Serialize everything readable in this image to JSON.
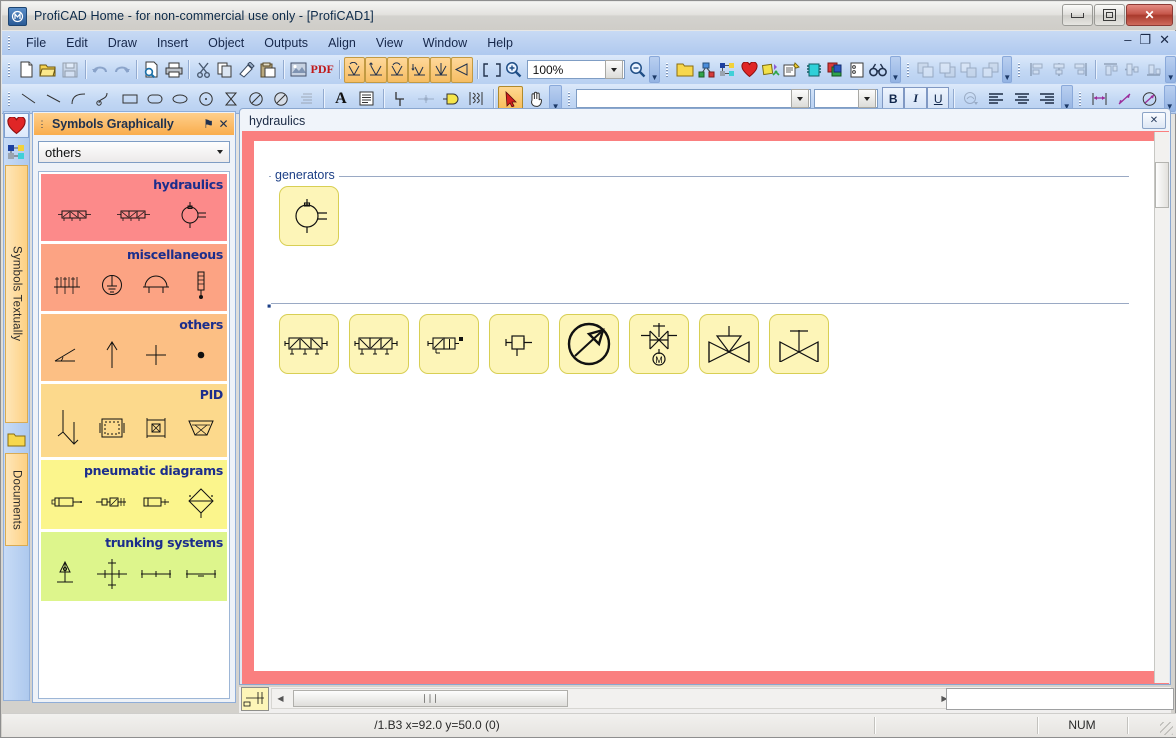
{
  "window": {
    "title": "ProfiCAD Home - for non-commercial use only - [ProfiCAD1]",
    "app_icon": "proficad-icon",
    "minimize": "–",
    "maximize": "□",
    "close": "✕"
  },
  "mdi_controls": {
    "minimize": "–",
    "restore": "❐",
    "close": "✕"
  },
  "menu": {
    "items": [
      {
        "label": "File"
      },
      {
        "label": "Edit"
      },
      {
        "label": "Draw"
      },
      {
        "label": "Insert"
      },
      {
        "label": "Object"
      },
      {
        "label": "Outputs"
      },
      {
        "label": "Align"
      },
      {
        "label": "View"
      },
      {
        "label": "Window"
      },
      {
        "label": "Help"
      }
    ]
  },
  "toolbar_main": {
    "zoom_value": "100%",
    "buttons": [
      {
        "name": "new-icon",
        "label": "New"
      },
      {
        "name": "open-icon",
        "label": "Open"
      },
      {
        "name": "save-icon",
        "label": "Save"
      },
      {
        "name": "undo-icon",
        "label": "Undo"
      },
      {
        "name": "redo-icon",
        "label": "Redo"
      },
      {
        "name": "print-preview-icon",
        "label": "Print Preview"
      },
      {
        "name": "print-icon",
        "label": "Print"
      },
      {
        "name": "cut-icon",
        "label": "Cut"
      },
      {
        "name": "copy-icon",
        "label": "Copy"
      },
      {
        "name": "format-painter-icon",
        "label": "Format Painter"
      },
      {
        "name": "paste-icon",
        "label": "Paste"
      },
      {
        "name": "image-export-icon",
        "label": "Export Image"
      },
      {
        "name": "pdf-icon",
        "label": "PDF"
      },
      {
        "name": "rotate-left-icon",
        "label": "Rotate Left"
      },
      {
        "name": "rotate-right-icon",
        "label": "Rotate Right"
      },
      {
        "name": "rotate-180-icon",
        "label": "Rotate 180"
      },
      {
        "name": "flip-vertical-icon",
        "label": "Flip Vertical"
      },
      {
        "name": "mirror-horizontal-icon",
        "label": "Mirror Horizontal"
      },
      {
        "name": "mirror-vertical-icon",
        "label": "Mirror Vertical"
      },
      {
        "name": "zoom-fit-icon",
        "label": "Zoom to Fit"
      },
      {
        "name": "zoom-in-icon",
        "label": "Zoom In"
      },
      {
        "name": "zoom-out-icon",
        "label": "Zoom Out"
      }
    ]
  },
  "toolbar_panels": {
    "buttons": [
      {
        "name": "folder-icon",
        "label": "Symbol Library"
      },
      {
        "name": "netlist-icon",
        "label": "Netlist"
      },
      {
        "name": "hierarchy-icon",
        "label": "Hierarchy"
      },
      {
        "name": "favorites-heart-icon",
        "label": "Favorites"
      },
      {
        "name": "symbols-graphically-icon",
        "label": "Symbols Graphically"
      },
      {
        "name": "notes-icon",
        "label": "Notes"
      },
      {
        "name": "component-icon",
        "label": "Component"
      },
      {
        "name": "layers-icon",
        "label": "Layers"
      },
      {
        "name": "page-icon",
        "label": "Page"
      },
      {
        "name": "find-icon",
        "label": "Find"
      }
    ]
  },
  "toolbar_order": {
    "buttons": [
      {
        "name": "bring-to-front-icon",
        "label": "Bring to Front"
      },
      {
        "name": "send-to-back-icon",
        "label": "Send to Back"
      },
      {
        "name": "bring-forward-icon",
        "label": "Bring Forward"
      },
      {
        "name": "send-backward-icon",
        "label": "Send Backward"
      }
    ]
  },
  "toolbar_align": {
    "buttons": [
      {
        "name": "align-left-icon",
        "label": "Align Left"
      },
      {
        "name": "align-center-icon",
        "label": "Align Center"
      },
      {
        "name": "align-right-icon",
        "label": "Align Right"
      },
      {
        "name": "align-top-icon",
        "label": "Align Top"
      },
      {
        "name": "align-middle-icon",
        "label": "Align Middle"
      },
      {
        "name": "align-bottom-icon",
        "label": "Align Bottom"
      }
    ]
  },
  "toolbar_draw": {
    "font_name": "",
    "font_size": "",
    "bold_label": "B",
    "italic_label": "I",
    "underline_label": "U",
    "buttons": [
      {
        "name": "line-icon",
        "label": "Line"
      },
      {
        "name": "line2-icon",
        "label": "Line"
      },
      {
        "name": "arc-icon",
        "label": "Arc"
      },
      {
        "name": "bezier-icon",
        "label": "Bezier"
      },
      {
        "name": "rectangle-icon",
        "label": "Rectangle"
      },
      {
        "name": "rounded-rectangle-icon",
        "label": "Rounded Rectangle"
      },
      {
        "name": "ellipse-icon",
        "label": "Ellipse"
      },
      {
        "name": "circle-icon",
        "label": "Circle"
      },
      {
        "name": "hourglass-icon",
        "label": "Hourglass"
      },
      {
        "name": "no-fill-ellipse-icon",
        "label": "Ellipse Slash"
      },
      {
        "name": "filled-ellipse-icon",
        "label": "Filled Ellipse"
      },
      {
        "name": "hatch-icon",
        "label": "Hatch"
      },
      {
        "name": "text-icon",
        "label": "Text"
      },
      {
        "name": "textbox-icon",
        "label": "Text Box"
      },
      {
        "name": "wire-icon",
        "label": "Wire"
      },
      {
        "name": "junction-icon",
        "label": "Junction"
      },
      {
        "name": "terminal-icon",
        "label": "Terminal"
      },
      {
        "name": "bus-icon",
        "label": "Bus"
      },
      {
        "name": "select-arrow-icon",
        "label": "Select"
      },
      {
        "name": "pan-hand-icon",
        "label": "Pan"
      },
      {
        "name": "color-picker-icon",
        "label": "Color"
      },
      {
        "name": "align-text-left-icon",
        "label": "Align Text Left"
      },
      {
        "name": "align-text-center-icon",
        "label": "Align Text Center"
      },
      {
        "name": "align-text-right-icon",
        "label": "Align Text Right"
      },
      {
        "name": "dimension-linear-icon",
        "label": "Linear Dimension"
      },
      {
        "name": "dimension-angular-icon",
        "label": "Angular Dimension"
      },
      {
        "name": "dimension-radial-icon",
        "label": "Radial Dimension"
      }
    ]
  },
  "dock": {
    "icons": [
      {
        "name": "favorites-heart-icon",
        "label": "Favorites",
        "selected": true
      },
      {
        "name": "symbols-graphically-icon",
        "label": "Symbols Graphically",
        "selected": false
      }
    ],
    "tabs": [
      {
        "label": "Symbols Textually",
        "name": "symbols-textually"
      },
      {
        "label": "Documents",
        "name": "documents"
      }
    ]
  },
  "symbols_panel": {
    "title": "Symbols Graphically",
    "pin_glyph": "⚑",
    "close_glyph": "✕",
    "selected_library": "others",
    "groups": [
      {
        "title": "hydraulics",
        "color": "#fc8a8a",
        "symbols": [
          "hydraulic-valve-1",
          "hydraulic-valve-2",
          "hydraulic-pump"
        ]
      },
      {
        "title": "miscellaneous",
        "color": "#fca383",
        "symbols": [
          "terminal-strip",
          "earth-circle",
          "umbrella",
          "thermometer"
        ]
      },
      {
        "title": "others",
        "color": "#fcbf84",
        "symbols": [
          "angle",
          "arrow-up",
          "cross",
          "dot"
        ]
      },
      {
        "title": "PID",
        "color": "#fcd98c",
        "symbols": [
          "pid-curve",
          "pid-box",
          "pid-grid",
          "pid-funnel"
        ]
      },
      {
        "title": "pneumatic diagrams",
        "color": "#fbf58c",
        "symbols": [
          "cylinder-1",
          "cylinder-2",
          "cylinder-3",
          "diamond-valve"
        ]
      },
      {
        "title": "trunking systems",
        "color": "#ddf58c",
        "symbols": [
          "trunk-riser",
          "trunk-cross",
          "trunk-run",
          "trunk-segment"
        ]
      }
    ]
  },
  "document": {
    "tab_label": "hydraulics",
    "close_glyph": "✕",
    "sections": [
      {
        "legend": "generators",
        "name": "generators-section",
        "symbols": [
          {
            "name": "hydraulic-pump-generator"
          }
        ]
      },
      {
        "legend": "",
        "name": "valves-section",
        "symbols": [
          {
            "name": "directional-valve-4-way-a"
          },
          {
            "name": "directional-valve-4-way-b"
          },
          {
            "name": "directional-valve-2-way"
          },
          {
            "name": "single-acting-cylinder"
          },
          {
            "name": "pump-circle-arrow"
          },
          {
            "name": "motorized-valve"
          },
          {
            "name": "control-valve-actuator"
          },
          {
            "name": "butterfly-valve"
          }
        ]
      }
    ]
  },
  "bottom_bar": {
    "scroll_thumb_glyph": "∣∣∣",
    "left_arrow": "◀",
    "right_arrow": "▶",
    "text_field_value": ""
  },
  "status_bar": {
    "coordinates": "/1.B3  x=92.0  y=50.0 (0)",
    "num_lock": "NUM"
  },
  "colors": {
    "canvas_border": "#fa7f7f",
    "symbol_fill": "#fdf5b8",
    "symbol_border": "#d8cf54",
    "panel_header": "#f9ad4d",
    "legend_text": "#1c3f86",
    "group_title": "#1b2d8c"
  }
}
